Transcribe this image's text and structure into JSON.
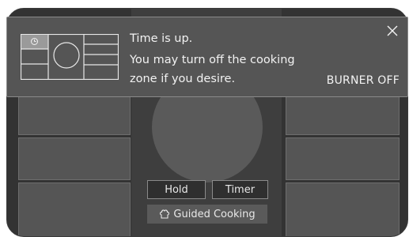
{
  "notification": {
    "line1": "Time is up.",
    "line2": "You may turn off the cooking",
    "line3": "zone if you desire.",
    "action": "BURNER OFF",
    "close_icon": "close-icon",
    "zone_icon": "cooktop-zone-icon"
  },
  "controls": {
    "hold": "Hold",
    "timer": "Timer",
    "guided": "Guided Cooking",
    "guided_icon": "chef-hat-icon"
  },
  "colors": {
    "background": "#333333",
    "panel": "#555555",
    "text": "#f2f2f2"
  }
}
